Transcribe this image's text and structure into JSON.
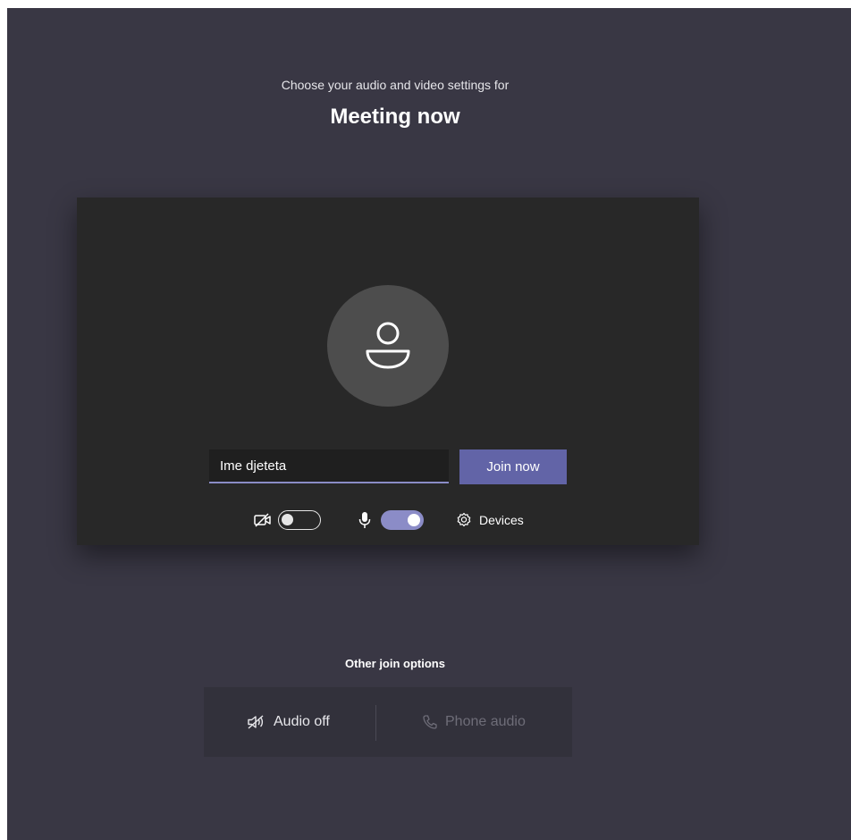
{
  "header": {
    "subtitle": "Choose your audio and video settings for",
    "title": "Meeting now"
  },
  "preview": {
    "avatar_icon": "person-icon",
    "name_value": "Ime djeteta",
    "join_label": "Join now"
  },
  "controls": {
    "camera": {
      "icon": "camera-off-icon",
      "state": "off"
    },
    "mic": {
      "icon": "microphone-icon",
      "state": "on"
    },
    "devices_label": "Devices",
    "devices_icon": "gear-icon"
  },
  "other_options": {
    "title": "Other join options",
    "audio_off_label": "Audio off",
    "phone_audio_label": "Phone audio"
  },
  "colors": {
    "background": "#393744",
    "accent": "#6264a7",
    "toggle_on": "#8b8cc7"
  }
}
